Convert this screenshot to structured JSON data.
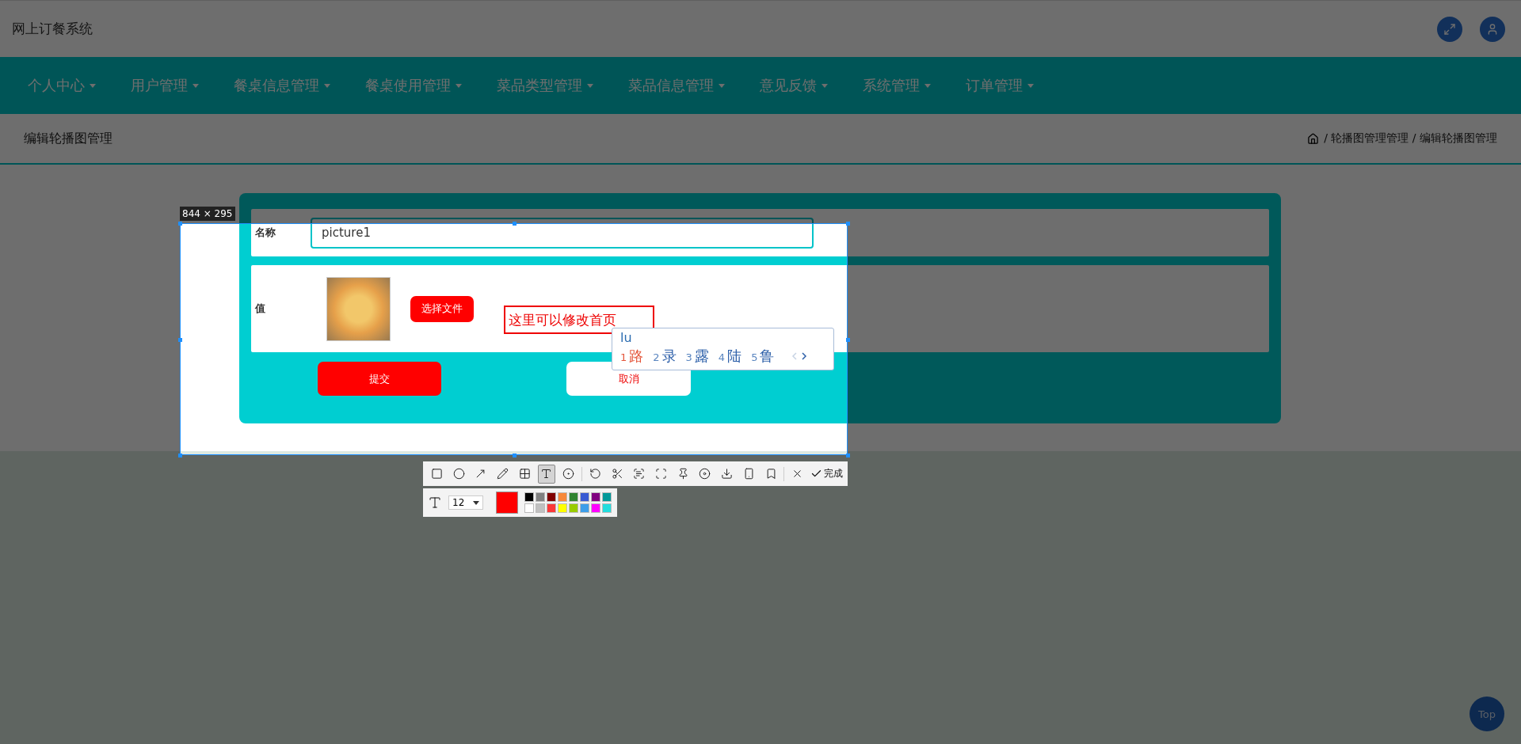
{
  "header": {
    "title": "网上订餐系统"
  },
  "nav": [
    {
      "label": "个人中心"
    },
    {
      "label": "用户管理"
    },
    {
      "label": "餐桌信息管理"
    },
    {
      "label": "餐桌使用管理"
    },
    {
      "label": "菜品类型管理"
    },
    {
      "label": "菜品信息管理"
    },
    {
      "label": "意见反馈"
    },
    {
      "label": "系统管理"
    },
    {
      "label": "订单管理"
    }
  ],
  "page_header": {
    "title": "编辑轮播图管理",
    "breadcrumb": "/ 轮播图管理管理 / 编辑轮播图管理"
  },
  "form": {
    "name_label": "名称",
    "name_value": "picture1",
    "value_label": "值",
    "file_button": "选择文件",
    "submit": "提交",
    "cancel": "取消"
  },
  "screenshot_tool": {
    "size_label": "844 × 295",
    "annotation_text": "这里可以修改首页",
    "ime": {
      "input": "lu",
      "candidates": [
        {
          "index": "1",
          "text": "路",
          "selected": true
        },
        {
          "index": "2",
          "text": "录",
          "selected": false
        },
        {
          "index": "3",
          "text": "露",
          "selected": false
        },
        {
          "index": "4",
          "text": "陆",
          "selected": false
        },
        {
          "index": "5",
          "text": "鲁",
          "selected": false
        }
      ]
    },
    "tool_groups": [
      {
        "tools": [
          {
            "kind": "rectangle",
            "selected": false
          },
          {
            "kind": "ellipse",
            "selected": false
          },
          {
            "kind": "arrow",
            "selected": false
          },
          {
            "kind": "pencil",
            "selected": false
          },
          {
            "kind": "mosaic",
            "selected": false
          },
          {
            "kind": "text",
            "selected": true
          },
          {
            "kind": "serial",
            "selected": false
          }
        ]
      },
      {
        "tools": [
          {
            "kind": "undo",
            "selected": false
          },
          {
            "kind": "scissors",
            "selected": false
          },
          {
            "kind": "ocr",
            "selected": false
          },
          {
            "kind": "scroll",
            "selected": false
          },
          {
            "kind": "pin",
            "selected": false
          },
          {
            "kind": "record",
            "selected": false
          },
          {
            "kind": "download",
            "selected": false
          },
          {
            "kind": "phone",
            "selected": false
          },
          {
            "kind": "bookmark",
            "selected": false
          }
        ]
      },
      {
        "tools": [
          {
            "kind": "close",
            "selected": false
          }
        ]
      }
    ],
    "done_label": "完成",
    "font_size": "12",
    "current_swatch": {
      "color": "#ff0000"
    },
    "palette": [
      {
        "color": "#000000"
      },
      {
        "color": "#808080"
      },
      {
        "color": "#800000"
      },
      {
        "color": "#f7883a"
      },
      {
        "color": "#308430"
      },
      {
        "color": "#385ad3"
      },
      {
        "color": "#800080"
      },
      {
        "color": "#009999"
      },
      {
        "color": "#ffffff"
      },
      {
        "color": "#c0c0c0"
      },
      {
        "color": "#fb3838"
      },
      {
        "color": "#ffff00"
      },
      {
        "color": "#99cc00"
      },
      {
        "color": "#3d9ee9"
      },
      {
        "color": "#ff00ff"
      },
      {
        "color": "#22dddd"
      }
    ]
  },
  "top_button": "Top"
}
